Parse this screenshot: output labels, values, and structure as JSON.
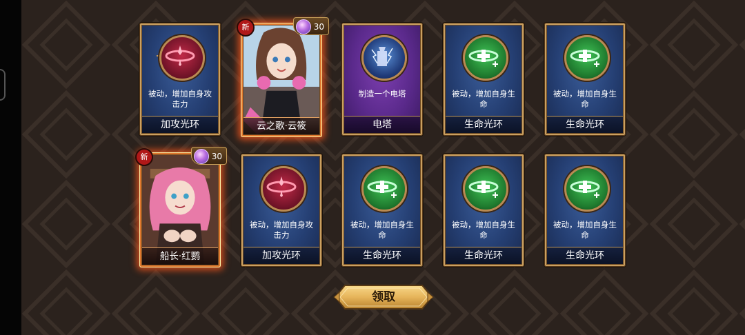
{
  "rewards": {
    "row1": [
      {
        "type": "skill",
        "icon": "attack-aura-icon",
        "orb": "red",
        "desc": "被动，增加自身攻击力",
        "name": "加攻光环"
      },
      {
        "type": "hero",
        "new_label": "新",
        "cost": "30",
        "name": "云之歌·云筱"
      },
      {
        "type": "skill",
        "icon": "lightning-tower-icon",
        "orb": "storm",
        "desc": "制造一个电塔",
        "name": "电塔",
        "purple": true
      },
      {
        "type": "skill",
        "icon": "life-aura-icon",
        "orb": "green",
        "desc": "被动，增加自身生命",
        "name": "生命光环"
      },
      {
        "type": "skill",
        "icon": "life-aura-icon",
        "orb": "green",
        "desc": "被动，增加自身生命",
        "name": "生命光环"
      }
    ],
    "row2": [
      {
        "type": "hero",
        "new_label": "新",
        "cost": "30",
        "name": "船长·红鹦"
      },
      {
        "type": "skill",
        "icon": "attack-aura-icon",
        "orb": "red",
        "desc": "被动，增加自身攻击力",
        "name": "加攻光环"
      },
      {
        "type": "skill",
        "icon": "life-aura-icon",
        "orb": "green",
        "desc": "被动，增加自身生命",
        "name": "生命光环"
      },
      {
        "type": "skill",
        "icon": "life-aura-icon",
        "orb": "green",
        "desc": "被动，增加自身生命",
        "name": "生命光环"
      },
      {
        "type": "skill",
        "icon": "life-aura-icon",
        "orb": "green",
        "desc": "被动，增加自身生命",
        "name": "生命光环"
      }
    ]
  },
  "claim_button": {
    "label": "领取"
  },
  "colors": {
    "background": "#2b221d",
    "card_frame": "#caa061",
    "hero_glow": "#ff5a1e",
    "button_gold": "#e6b45a"
  }
}
